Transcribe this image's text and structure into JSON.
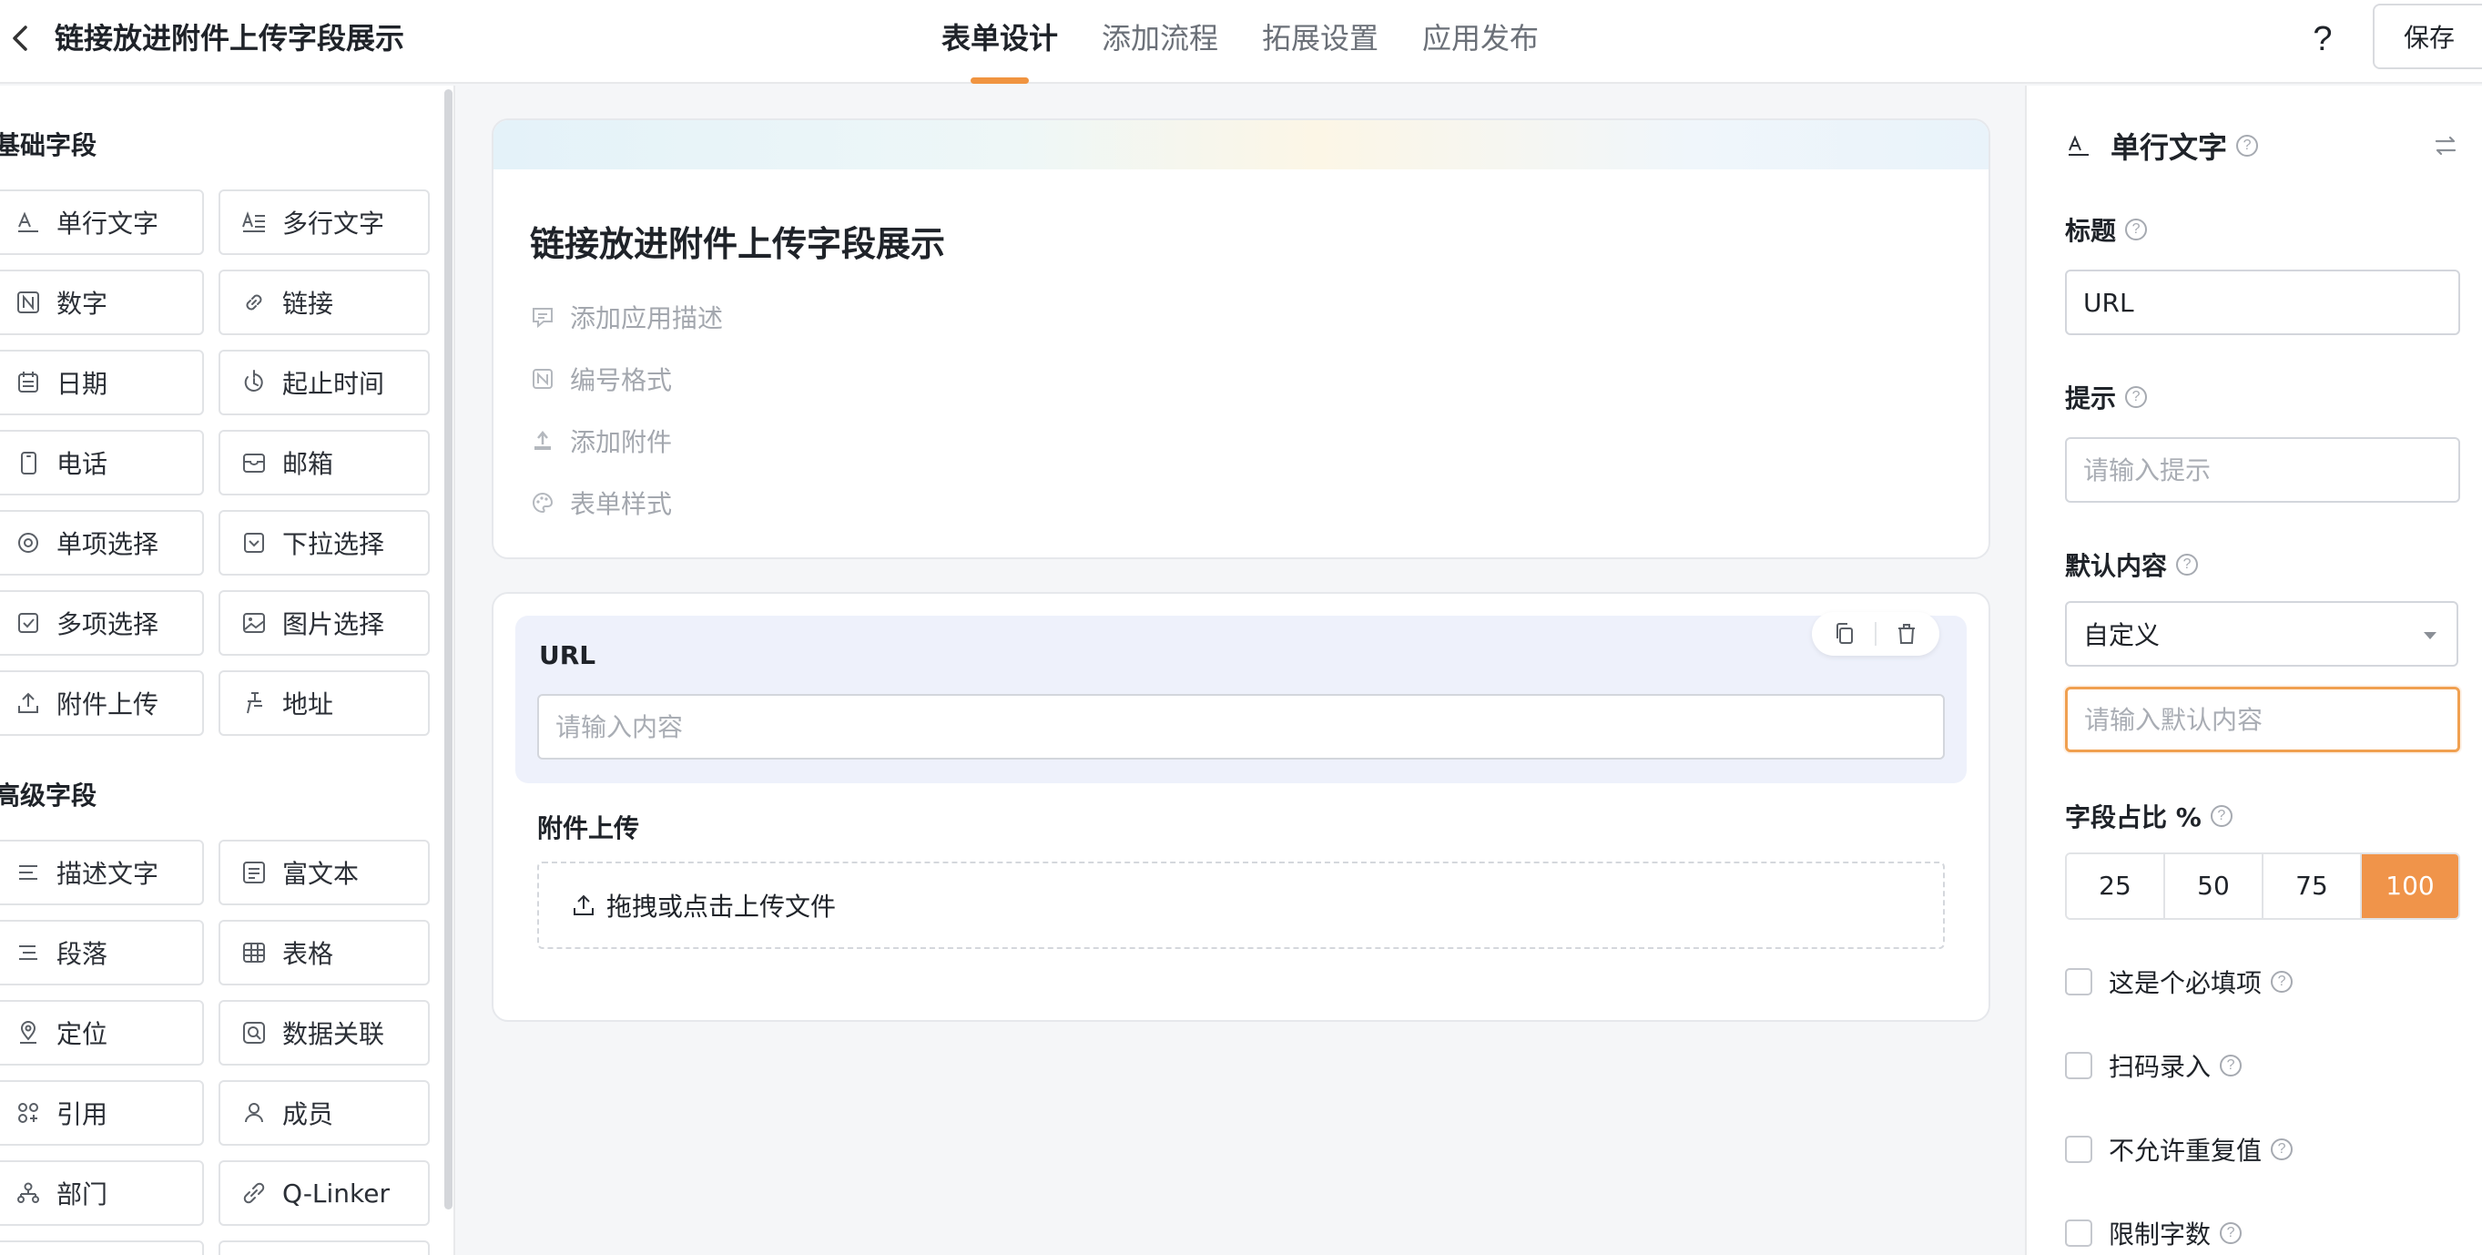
{
  "topbar": {
    "title": "链接放进附件上传字段展示",
    "tabs": [
      {
        "label": "表单设计",
        "active": true
      },
      {
        "label": "添加流程",
        "active": false
      },
      {
        "label": "拓展设置",
        "active": false
      },
      {
        "label": "应用发布",
        "active": false
      }
    ],
    "help_label": "?",
    "save_label": "保存"
  },
  "left_panel": {
    "basic_title": "基础字段",
    "basic_fields": [
      {
        "label": "单行文字",
        "icon": "text-icon"
      },
      {
        "label": "多行文字",
        "icon": "multiline-text-icon"
      },
      {
        "label": "数字",
        "icon": "number-icon"
      },
      {
        "label": "链接",
        "icon": "link-icon"
      },
      {
        "label": "日期",
        "icon": "calendar-icon"
      },
      {
        "label": "起止时间",
        "icon": "time-range-icon"
      },
      {
        "label": "电话",
        "icon": "phone-icon"
      },
      {
        "label": "邮箱",
        "icon": "mail-icon"
      },
      {
        "label": "单项选择",
        "icon": "radio-icon"
      },
      {
        "label": "下拉选择",
        "icon": "dropdown-icon"
      },
      {
        "label": "多项选择",
        "icon": "checkbox-icon"
      },
      {
        "label": "图片选择",
        "icon": "image-icon"
      },
      {
        "label": "附件上传",
        "icon": "upload-icon"
      },
      {
        "label": "地址",
        "icon": "address-icon"
      }
    ],
    "advanced_title": "高级字段",
    "advanced_fields": [
      {
        "label": "描述文字",
        "icon": "description-icon"
      },
      {
        "label": "富文本",
        "icon": "rich-text-icon"
      },
      {
        "label": "段落",
        "icon": "paragraph-icon"
      },
      {
        "label": "表格",
        "icon": "table-icon"
      },
      {
        "label": "定位",
        "icon": "location-icon"
      },
      {
        "label": "数据关联",
        "icon": "data-link-icon"
      },
      {
        "label": "引用",
        "icon": "reference-icon"
      },
      {
        "label": "成员",
        "icon": "member-icon"
      },
      {
        "label": "部门",
        "icon": "department-icon"
      },
      {
        "label": "Q-Linker",
        "icon": "qlinker-icon"
      }
    ]
  },
  "form": {
    "title": "链接放进附件上传字段展示",
    "meta_items": [
      {
        "label": "添加应用描述",
        "icon": "comment-icon"
      },
      {
        "label": "编号格式",
        "icon": "number-format-icon"
      },
      {
        "label": "添加附件",
        "icon": "attach-upload-icon"
      },
      {
        "label": "表单样式",
        "icon": "palette-icon"
      }
    ],
    "url_field": {
      "label": "URL",
      "placeholder": "请输入内容"
    },
    "attachment_field": {
      "label": "附件上传",
      "dropzone_text": "拖拽或点击上传文件"
    }
  },
  "right_panel": {
    "field_type": "单行文字",
    "title_label": "标题",
    "title_value": "URL",
    "hint_label": "提示",
    "hint_placeholder": "请输入提示",
    "default_label": "默认内容",
    "default_select": "自定义",
    "default_placeholder": "请输入默认内容",
    "width_label": "字段占比 %",
    "width_options": [
      "25",
      "50",
      "75",
      "100"
    ],
    "width_selected": "100",
    "checkboxes": [
      {
        "label": "这是个必填项",
        "checked": false
      },
      {
        "label": "扫码录入",
        "checked": false
      },
      {
        "label": "不允许重复值",
        "checked": false
      },
      {
        "label": "限制字数",
        "checked": false
      }
    ]
  },
  "colors": {
    "accent": "#f0944a",
    "focus_border": "#f0a050",
    "selected_block": "#eef1fb"
  }
}
